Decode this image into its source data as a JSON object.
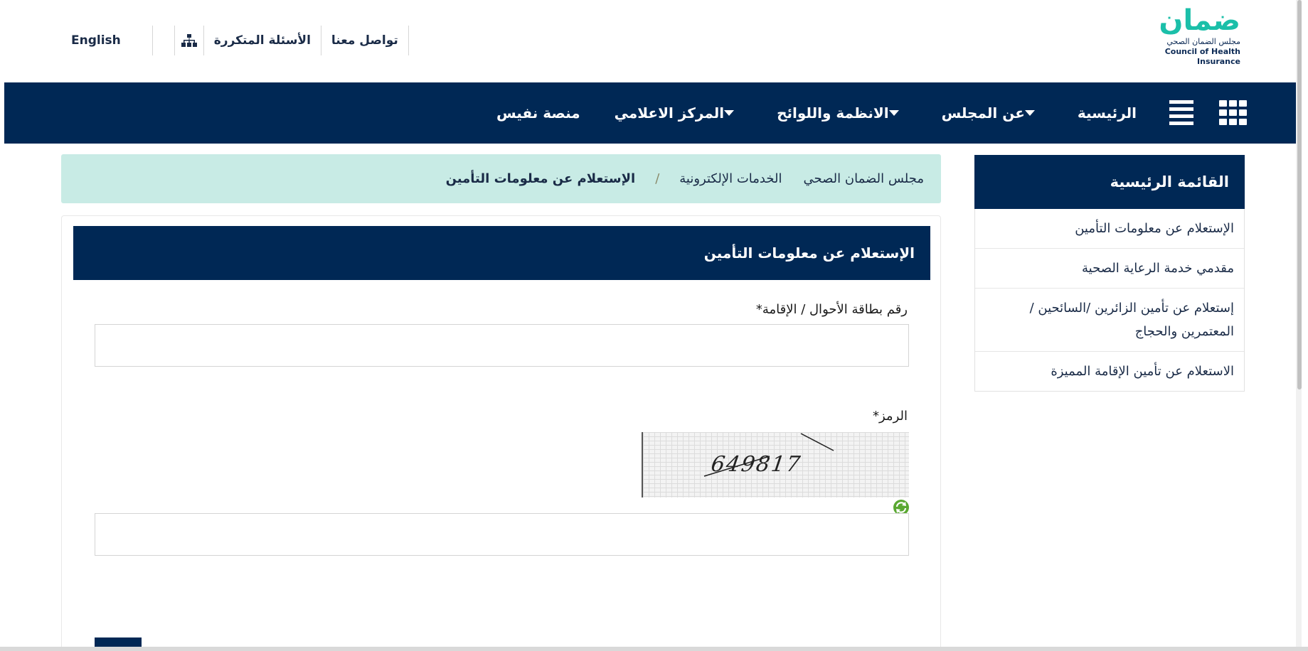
{
  "header": {
    "logo": {
      "word": "ضمان",
      "sub_ar": "مجلس الضمان الصحي",
      "sub_en": "Council of Health Insurance"
    },
    "links": {
      "english": "English",
      "faq": "الأسئلة المتكررة",
      "contact": "تواصل معنا"
    }
  },
  "nav": {
    "items": [
      {
        "label": "الرئيسية",
        "dropdown": false
      },
      {
        "label": "عن المجلس",
        "dropdown": true
      },
      {
        "label": "الانظمة واللوائح",
        "dropdown": true
      },
      {
        "label": "المركز الاعلامي",
        "dropdown": true
      },
      {
        "label": "منصة نفيس",
        "dropdown": false
      }
    ]
  },
  "sidebar": {
    "title": "القائمة الرئيسية",
    "items": [
      {
        "label": "الإستعلام عن معلومات التأمين"
      },
      {
        "label": "مقدمي خدمة الرعاية الصحية"
      },
      {
        "label": "إستعلام عن تأمين الزائرين /السائحين / المعتمرين والحجاج"
      },
      {
        "label": "الاستعلام عن تأمين الإقامة المميزة"
      }
    ]
  },
  "breadcrumb": {
    "items": [
      {
        "label": "مجلس الضمان الصحي"
      },
      {
        "label": "الخدمات الإلكترونية"
      }
    ],
    "separator": "/",
    "current": "الإستعلام عن معلومات التأمين"
  },
  "form": {
    "title": "الإستعلام عن معلومات التأمين",
    "id_label": "رقم بطاقة الأحوال / الإقامة*",
    "id_value": "",
    "captcha_label": "الرمز*",
    "captcha_text": "649817",
    "captcha_value": ""
  },
  "colors": {
    "navy": "#002855",
    "mint": "#c8ebe5",
    "logo_blue": "#0a4da0",
    "logo_teal": "#1bbfa9"
  }
}
